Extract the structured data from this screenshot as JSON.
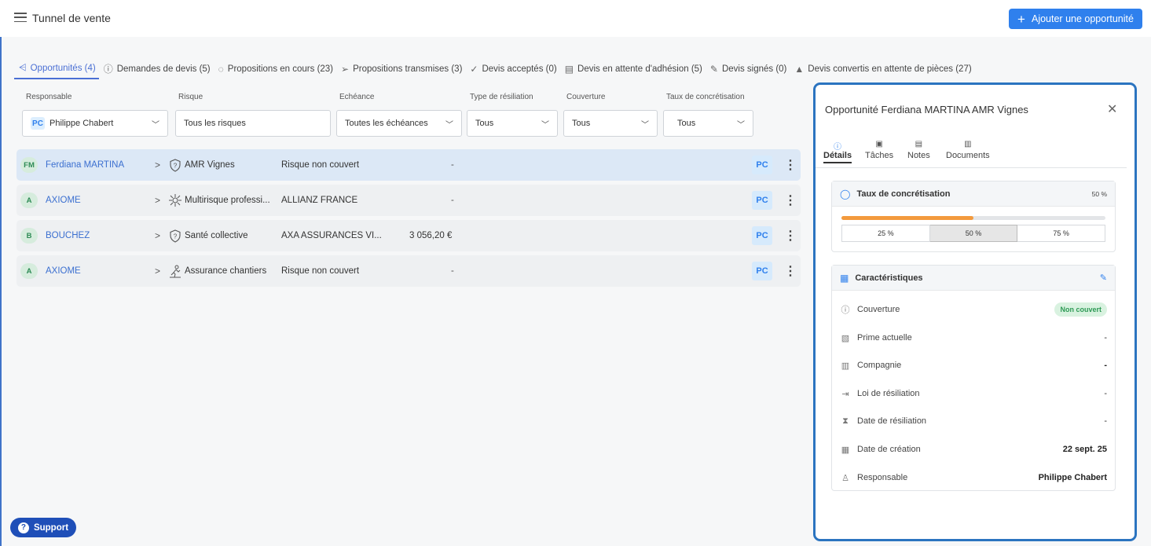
{
  "header": {
    "title": "Tunnel de vente",
    "add_button": "Ajouter une opportunité"
  },
  "tabs": [
    {
      "label": "Opportunités (4)",
      "icon": "funnel-icon",
      "active": true
    },
    {
      "label": "Demandes de devis (5)",
      "icon": "info-icon"
    },
    {
      "label": "Propositions en cours (23)",
      "icon": "spinner-icon"
    },
    {
      "label": "Propositions transmises (3)",
      "icon": "send-icon"
    },
    {
      "label": "Devis acceptés (0)",
      "icon": "check-circle-icon"
    },
    {
      "label": "Devis en attente d'adhésion (5)",
      "icon": "document-icon"
    },
    {
      "label": "Devis signés (0)",
      "icon": "signature-icon"
    },
    {
      "label": "Devis convertis en attente de pièces (27)",
      "icon": "warning-icon"
    }
  ],
  "filters": {
    "responsable": {
      "label": "Responsable",
      "value": "Philippe Chabert",
      "badge": "PC"
    },
    "risque": {
      "label": "Risque",
      "value": "Tous les risques"
    },
    "echeance": {
      "label": "Echéance",
      "value": "Toutes les échéances"
    },
    "type_resiliation": {
      "label": "Type de résiliation",
      "value": "Tous"
    },
    "couverture": {
      "label": "Couverture",
      "value": "Tous"
    },
    "taux": {
      "label": "Taux de concrétisation",
      "value": "Tous"
    }
  },
  "rows": [
    {
      "initials": "FM",
      "name": "Ferdiana MARTINA",
      "risk": "AMR Vignes",
      "company": "Risque non couvert",
      "amount": "",
      "echeance": "-",
      "owner": "PC",
      "selected": true
    },
    {
      "initials": "A",
      "name": "AXIOME",
      "risk": "Multirisque professi...",
      "company": "ALLIANZ FRANCE",
      "amount": "",
      "echeance": "-",
      "owner": "PC"
    },
    {
      "initials": "B",
      "name": "BOUCHEZ",
      "risk": "Santé collective",
      "company": "AXA ASSURANCES VI...",
      "amount": "3 056,20 €",
      "echeance": "",
      "owner": "PC"
    },
    {
      "initials": "A",
      "name": "AXIOME",
      "risk": "Assurance chantiers",
      "company": "Risque non couvert",
      "amount": "",
      "echeance": "-",
      "owner": "PC"
    }
  ],
  "support": {
    "label": "Support"
  },
  "panel": {
    "title": "Opportunité Ferdiana MARTINA AMR Vignes",
    "tabs": [
      "Détails",
      "Tâches",
      "Notes",
      "Documents"
    ],
    "taux": {
      "title": "Taux de concrétisation",
      "value": "50 %",
      "progress_percent": 50,
      "options": [
        "25 %",
        "50 %",
        "75 %"
      ],
      "selected_option": "50 %"
    },
    "caracteristiques": {
      "title": "Caractéristiques",
      "couverture_label": "Couverture",
      "couverture_value": "Non couvert",
      "prime_label": "Prime actuelle",
      "prime_value": "-",
      "compagnie_label": "Compagnie",
      "compagnie_value": "-",
      "loi_label": "Loi de résiliation",
      "loi_value": "-",
      "date_res_label": "Date de résiliation",
      "date_res_value": "-",
      "date_creation_label": "Date de création",
      "date_creation_value": "22 sept. 25",
      "responsable_label": "Responsable",
      "responsable_value": "Philippe Chabert"
    }
  },
  "colors": {
    "accent": "#2f80ed",
    "active_tab": "#4a6fd4",
    "progress": "#f39a3d",
    "panel_border": "#2b74c0",
    "support": "#1f4fb8"
  }
}
